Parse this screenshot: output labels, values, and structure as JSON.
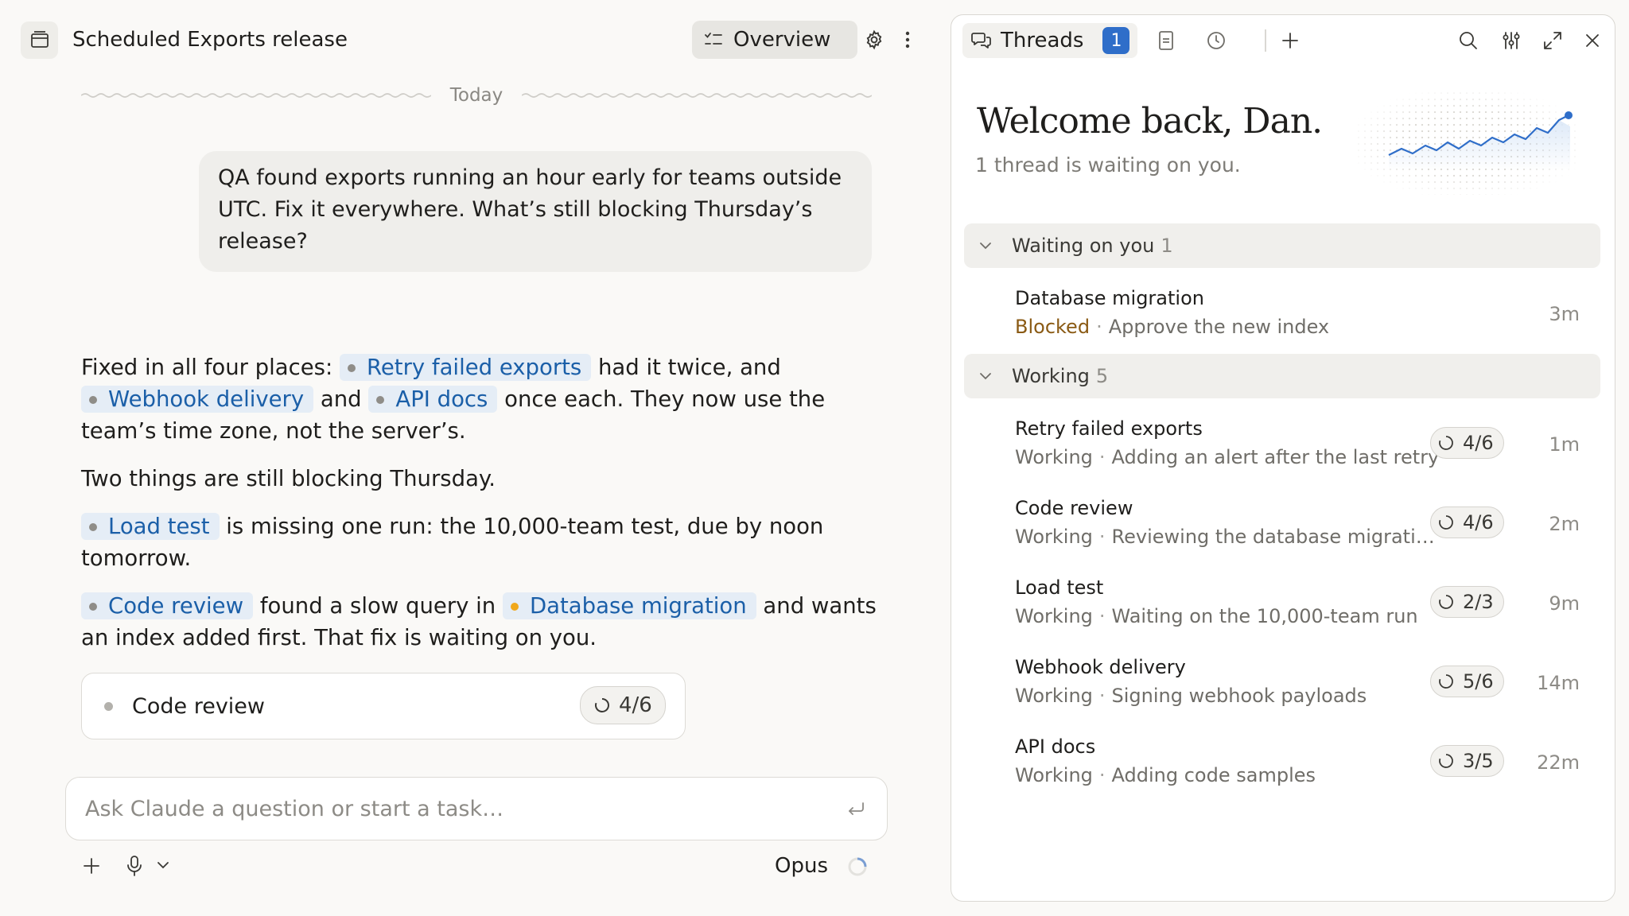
{
  "header": {
    "title": "Scheduled Exports release",
    "overview_label": "Overview"
  },
  "day_separator": "Today",
  "user_message": "QA found exports running an hour early for teams outside UTC. Fix it everywhere. What’s still blocking Thursday’s release?",
  "assistant": {
    "p1": {
      "t1": "Fixed in all four places:",
      "chip1": "Retry failed exports",
      "t2": "had it twice, and",
      "chip2": "Webhook delivery",
      "t3": "and",
      "chip3": "API docs",
      "t4": "once each. They now use the team’s time zone, not the server’s."
    },
    "p2": "Two things are still blocking Thursday.",
    "p3": {
      "chip": "Load test",
      "text": "is missing one run: the 10,000-team test, due by noon tomorrow."
    },
    "p4": {
      "chip1": "Code review",
      "t1": "found a slow query in",
      "chip2": "Database migration",
      "t2": "and wants an index added first. That fix is waiting on you."
    }
  },
  "task_card": {
    "name": "Code review",
    "progress": "4/6"
  },
  "composer": {
    "placeholder": "Ask Claude a question or start a task…",
    "model": "Opus"
  },
  "threads_panel": {
    "tab_label": "Threads",
    "badge": "1",
    "welcome": "Welcome back, Dan.",
    "welcome_sub": "1 thread is waiting on you.",
    "groups": [
      {
        "label": "Waiting on you",
        "count": "1",
        "items": [
          {
            "title": "Database migration",
            "status": "Blocked",
            "detail": "Approve the new index",
            "time": "3m"
          }
        ]
      },
      {
        "label": "Working",
        "count": "5",
        "items": [
          {
            "title": "Retry failed exports",
            "status": "Working",
            "detail": "Adding an alert after the last retry",
            "progress": "4/6",
            "time": "1m"
          },
          {
            "title": "Code review",
            "status": "Working",
            "detail": "Reviewing the database migrati…",
            "progress": "4/6",
            "time": "2m"
          },
          {
            "title": "Load test",
            "status": "Working",
            "detail": "Waiting on the 10,000-team run",
            "progress": "2/3",
            "time": "9m"
          },
          {
            "title": "Webhook delivery",
            "status": "Working",
            "detail": "Signing webhook payloads",
            "progress": "5/6",
            "time": "14m"
          },
          {
            "title": "API docs",
            "status": "Working",
            "detail": "Adding code samples",
            "progress": "3/5",
            "time": "22m"
          }
        ]
      }
    ]
  },
  "colors": {
    "accent_blue": "#2f6ec9",
    "chip_text": "#1b5fa8",
    "blocked_status": "#8a5a14",
    "amber_dot": "#f0a81c"
  }
}
